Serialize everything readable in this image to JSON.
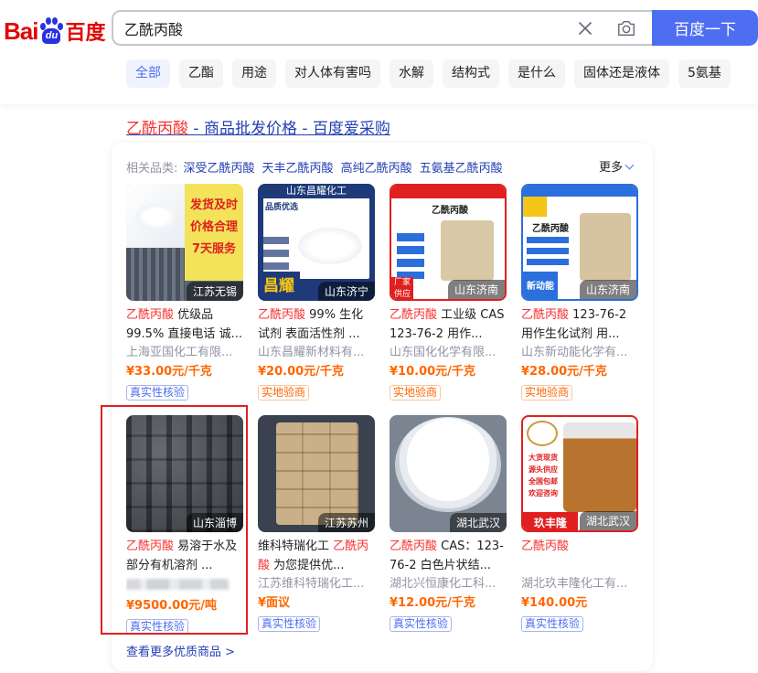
{
  "header": {
    "logo_text_left": "Bai",
    "logo_text_du": "du",
    "logo_text_right": "百度",
    "search_value": "乙酰丙酸",
    "search_button": "百度一下",
    "tabs": [
      "全部",
      "乙酯",
      "用途",
      "对人体有害吗",
      "水解",
      "结构式",
      "是什么",
      "固体还是液体",
      "5氨基"
    ]
  },
  "result": {
    "title_highlight": "乙酰丙酸",
    "title_rest": " - 商品批发价格 - 百度爱采购",
    "related_label": "相关品类:",
    "related_items": [
      "深受乙酰丙酸",
      "天丰乙酰丙酸",
      "高纯乙酰丙酸",
      "五氨基乙酰丙酸"
    ],
    "more_label": "更多",
    "see_more": "查看更多优质商品 >"
  },
  "products": [
    {
      "location": "江苏无锡",
      "name_hl": "乙酰丙酸",
      "name_rest": " 优级品99.5% 直接电话 诚...",
      "company": "上海亚国化工有限...",
      "price": "¥33.00元/千克",
      "badge": "真实性核验",
      "badge_style": "blue",
      "img_text": [
        "发货及时",
        "价格合理",
        "7天服务"
      ]
    },
    {
      "location": "山东济宁",
      "name_hl": "乙酰丙酸",
      "name_rest": " 99% 生化试剂 表面活性剂 ...",
      "company": "山东昌耀新材料有...",
      "price": "¥20.00元/千克",
      "badge": "实地验商",
      "badge_style": "orange",
      "img_text": [
        "山东昌耀化工",
        "品质优选",
        "昌耀"
      ]
    },
    {
      "location": "山东济南",
      "name_hl": "乙酰丙酸",
      "name_rest": " 工业级 CAS 123-76-2 用作...",
      "company": "山东国化化学有限...",
      "price": "¥10.00元/千克",
      "badge": "实地验商",
      "badge_style": "orange",
      "img_text": [
        "乙酰丙酸",
        "厂家供应"
      ]
    },
    {
      "location": "山东济南",
      "name_hl": "乙酰丙酸",
      "name_rest": " 123-76-2 用作生化试剂 用...",
      "company": "山东新动能化学有...",
      "price": "¥28.00元/千克",
      "badge": "实地验商",
      "badge_style": "orange",
      "img_text": [
        "乙酰丙酸",
        "新动能"
      ]
    },
    {
      "location": "山东淄博",
      "name_hl": "乙酰丙酸",
      "name_rest": " 易溶于水及部分有机溶剂 ...",
      "company": "",
      "price": "¥9500.00元/吨",
      "badge": "真实性核验",
      "badge_style": "blue",
      "img_text": []
    },
    {
      "location": "江苏苏州",
      "name_pre": "维科特瑞化工 ",
      "name_hl": "乙酰丙酸",
      "name_rest": " 为您提供优...",
      "company": "江苏维科特瑞化工...",
      "price": "¥面议",
      "badge": "真实性核验",
      "badge_style": "blue",
      "img_text": []
    },
    {
      "location": "湖北武汉",
      "name_hl": "乙酰丙酸",
      "name_rest": " CAS：123-76-2 白色片状结...",
      "company": "湖北兴恒康化工科...",
      "price": "¥12.00元/千克",
      "badge": "真实性核验",
      "badge_style": "blue",
      "img_text": []
    },
    {
      "location": "湖北武汉",
      "name_hl": "乙酰丙酸",
      "name_rest": "",
      "company": "湖北玖丰隆化工有...",
      "price": "¥140.00元",
      "badge": "真实性核验",
      "badge_style": "blue",
      "img_text": [
        "大货现货",
        "源头供应",
        "全国包邮",
        "欢迎咨询",
        "玖丰隆"
      ]
    }
  ]
}
